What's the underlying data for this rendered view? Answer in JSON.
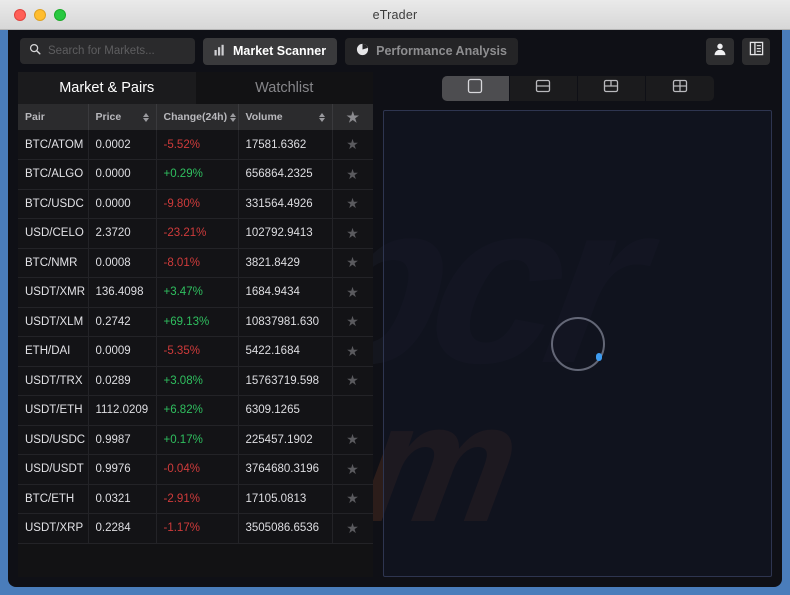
{
  "window": {
    "title": "eTrader",
    "controls": [
      "close",
      "minimize",
      "zoom"
    ]
  },
  "toolbar": {
    "search": {
      "value": "",
      "placeholder": "Search for Markets..."
    },
    "buttons": [
      {
        "label": "Market Scanner",
        "icon": "bar-chart-icon",
        "active": true
      },
      {
        "label": "Performance Analysis",
        "icon": "pie-chart-icon",
        "active": false
      }
    ],
    "right_icons": [
      {
        "name": "user-icon"
      },
      {
        "name": "panel-layout-icon"
      }
    ]
  },
  "left_panel": {
    "tabs": [
      {
        "label": "Market & Pairs",
        "active": true
      },
      {
        "label": "Watchlist",
        "active": false
      }
    ],
    "table": {
      "columns": [
        {
          "label": "Pair",
          "sortable": false
        },
        {
          "label": "Price",
          "sortable": true
        },
        {
          "label": "Change(24h)",
          "sortable": true
        },
        {
          "label": "Volume",
          "sortable": true
        },
        {
          "label": "",
          "icon": "star-icon",
          "sortable": false
        }
      ],
      "rows": [
        {
          "pair": "BTC/ATOM",
          "price": "0.0002",
          "change": "-5.52%",
          "dir": "down",
          "volume": "17581.6362",
          "star": true
        },
        {
          "pair": "BTC/ALGO",
          "price": "0.0000",
          "change": "+0.29%",
          "dir": "up",
          "volume": "656864.2325",
          "star": true
        },
        {
          "pair": "BTC/USDC",
          "price": "0.0000",
          "change": "-9.80%",
          "dir": "down",
          "volume": "331564.4926",
          "star": true
        },
        {
          "pair": "USD/CELO",
          "price": "2.3720",
          "change": "-23.21%",
          "dir": "down",
          "volume": "102792.9413",
          "star": true
        },
        {
          "pair": "BTC/NMR",
          "price": "0.0008",
          "change": "-8.01%",
          "dir": "down",
          "volume": "3821.8429",
          "star": true
        },
        {
          "pair": "USDT/XMR",
          "price": "136.4098",
          "change": "+3.47%",
          "dir": "up",
          "volume": "1684.9434",
          "star": true
        },
        {
          "pair": "USDT/XLM",
          "price": "0.2742",
          "change": "+69.13%",
          "dir": "up",
          "volume": "10837981.630",
          "star": true
        },
        {
          "pair": "ETH/DAI",
          "price": "0.0009",
          "change": "-5.35%",
          "dir": "down",
          "volume": "5422.1684",
          "star": true
        },
        {
          "pair": "USDT/TRX",
          "price": "0.0289",
          "change": "+3.08%",
          "dir": "up",
          "volume": "15763719.598",
          "star": true
        },
        {
          "pair": "USDT/ETH",
          "price": "1112.0209",
          "change": "+6.82%",
          "dir": "up",
          "volume": "6309.1265",
          "star": false
        },
        {
          "pair": "USD/USDC",
          "price": "0.9987",
          "change": "+0.17%",
          "dir": "up",
          "volume": "225457.1902",
          "star": true
        },
        {
          "pair": "USD/USDT",
          "price": "0.9976",
          "change": "-0.04%",
          "dir": "down",
          "volume": "3764680.3196",
          "star": true
        },
        {
          "pair": "BTC/ETH",
          "price": "0.0321",
          "change": "-2.91%",
          "dir": "down",
          "volume": "17105.0813",
          "star": true
        },
        {
          "pair": "USDT/XRP",
          "price": "0.2284",
          "change": "-1.17%",
          "dir": "down",
          "volume": "3505086.6536",
          "star": true
        }
      ]
    }
  },
  "right_panel": {
    "layout_options": [
      {
        "name": "layout-single",
        "active": true
      },
      {
        "name": "layout-split-rows",
        "active": false
      },
      {
        "name": "layout-three",
        "active": false
      },
      {
        "name": "layout-quad",
        "active": false
      }
    ],
    "chart": {
      "state": "loading",
      "spinner": "loading-spinner"
    }
  },
  "watermark": {
    "line1": "pcr",
    "line2": "com"
  },
  "colors": {
    "up": "#2fbf5f",
    "down": "#cf3b3b",
    "accent": "#3d9bf0",
    "app_bg": "#0f1016",
    "panel_bg": "#121214"
  }
}
